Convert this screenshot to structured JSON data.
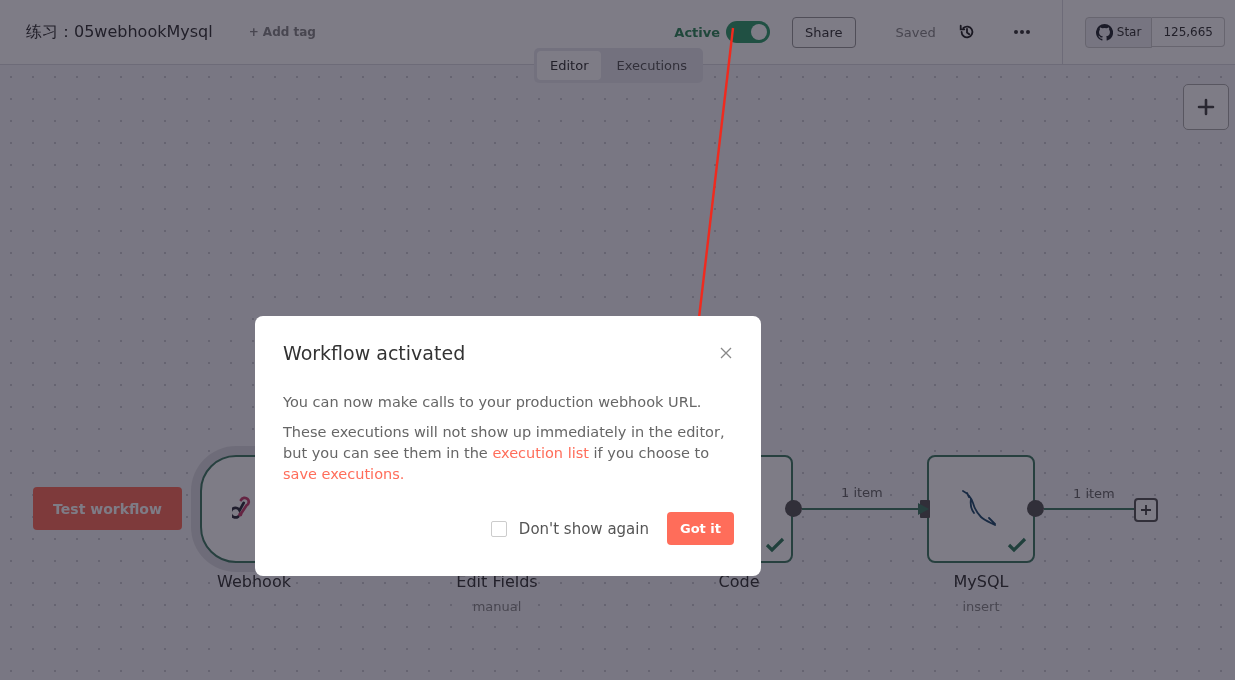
{
  "header": {
    "workflow_name": "练习：05webhookMysql",
    "add_tag": "+ Add tag",
    "active_label": "Active",
    "active": true,
    "share": "Share",
    "save_status": "Saved",
    "star": "Star",
    "star_count": "125,665"
  },
  "view_tabs": [
    {
      "label": "Editor",
      "selected": true
    },
    {
      "label": "Executions",
      "selected": false
    }
  ],
  "canvas": {
    "test_button": "Test workflow",
    "nodes": [
      {
        "kind": "trigger",
        "name": "Webhook"
      },
      {
        "kind": "hidden",
        "name": "Edit Fields",
        "subtitle": "manual"
      },
      {
        "kind": "code",
        "name": "Code",
        "succeeded": true
      },
      {
        "kind": "mysql",
        "name": "MySQL",
        "subtitle": "insert",
        "succeeded": true
      }
    ],
    "edges": [
      {
        "label": "1 item"
      },
      {
        "label": "1 item"
      }
    ]
  },
  "dialog": {
    "title": "Workflow activated",
    "line_1": "You can now make calls to your production webhook URL.",
    "line_2_start": "These executions will not show up immediately in the editor, but you can see them in the ",
    "link_1": "execution list",
    "line_2_mid": " if you choose to ",
    "link_2": "save executions.",
    "dont_show_again": "Don't show again",
    "dont_show_checked": false,
    "confirm": "Got it"
  }
}
